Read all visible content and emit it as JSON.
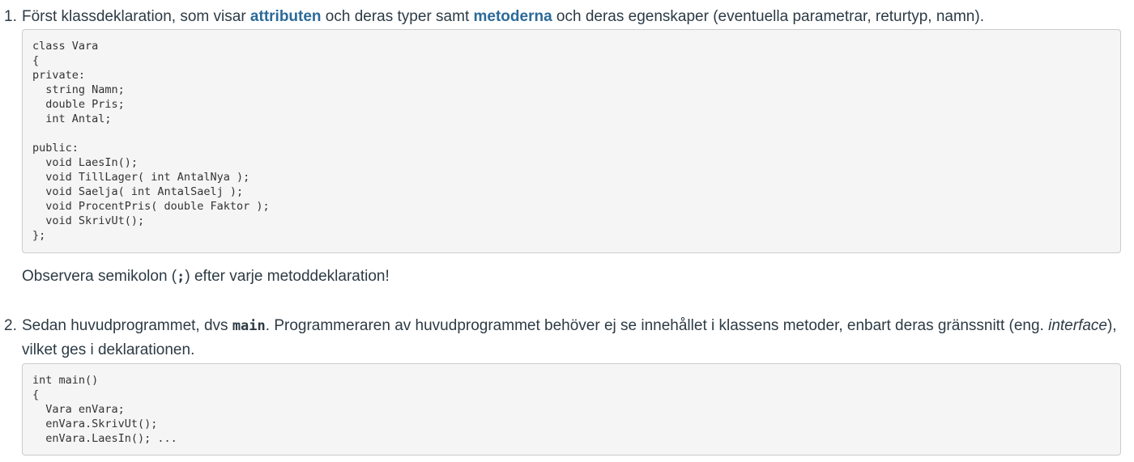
{
  "item1": {
    "number": "1.",
    "text_before": "Först klassdeklaration, som visar ",
    "kw_attributes": "attributen",
    "text_middle": " och deras typer samt ",
    "kw_methods": "metoderna",
    "text_after": " och deras egenskaper (eventuella parametrar, returtyp, namn).",
    "code": "class Vara\n{\nprivate:\n  string Namn;\n  double Pris;\n  int Antal;\n\npublic:\n  void LaesIn();\n  void TillLager( int AntalNya );\n  void Saelja( int AntalSaelj );\n  void ProcentPris( double Faktor );\n  void SkrivUt();\n};",
    "note_before": "Observera semikolon (",
    "note_code": ";",
    "note_after": ") efter varje metoddeklaration!"
  },
  "item2": {
    "number": "2.",
    "text_before": "Sedan huvudprogrammet, dvs ",
    "code_main": "main",
    "text_middle": ". Programmeraren av huvudprogrammet behöver ej se innehållet i klassens metoder, enbart deras gränssnitt (eng. ",
    "em_interface": "interface",
    "text_after": "), vilket ges i deklarationen.",
    "code": "int main()\n{\n  Vara enVara;\n  enVara.SkrivUt();\n  enVara.LaesIn(); ..."
  }
}
